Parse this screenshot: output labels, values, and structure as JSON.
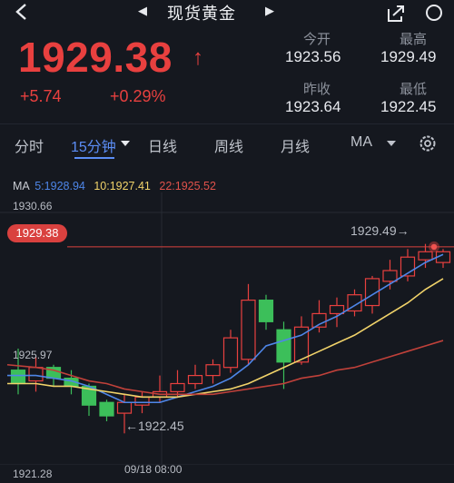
{
  "header": {
    "title": "现货黄金",
    "prev_icon": "triangle-left-icon",
    "next_icon": "triangle-right-icon"
  },
  "quote": {
    "price": "1929.38",
    "change": "+5.74",
    "change_pct": "+0.29%",
    "arrow": "↑",
    "color_up": "#e8403f",
    "color_down": "#3cbf5a"
  },
  "stats": {
    "open_label": "今开",
    "open": "1923.56",
    "high_label": "最高",
    "high": "1929.49",
    "prev_close_label": "昨收",
    "prev_close": "1923.64",
    "low_label": "最低",
    "low": "1922.45"
  },
  "tabs": {
    "fenshi": "分时",
    "min15": "15分钟",
    "daily": "日线",
    "weekly": "周线",
    "monthly": "月线",
    "ma": "MA"
  },
  "ma_legend": {
    "label": "MA",
    "ma5": "5:1928.94",
    "ma10": "10:1927.41",
    "ma22": "22:1925.52",
    "ma5_color": "#4e86e8",
    "ma10_color": "#f1d36a",
    "ma22_color": "#c0413a"
  },
  "axis": {
    "y_top": "1930.66",
    "y_mid": "1925.97",
    "y_bottom": "1921.28",
    "current_tag": "1929.38",
    "x_label": "09/18 08:00"
  },
  "annotations": {
    "high": "1929.49→",
    "low": "←1922.45"
  },
  "chart_data": {
    "type": "candlestick",
    "ylim": [
      1921.28,
      1930.66
    ],
    "current_price": 1929.38,
    "candles": [
      {
        "o": 1924.8,
        "h": 1925.6,
        "l": 1923.9,
        "c": 1924.3
      },
      {
        "o": 1924.4,
        "h": 1925.3,
        "l": 1924.0,
        "c": 1924.9
      },
      {
        "o": 1924.9,
        "h": 1925.0,
        "l": 1924.2,
        "c": 1924.5
      },
      {
        "o": 1924.5,
        "h": 1924.8,
        "l": 1923.9,
        "c": 1924.2
      },
      {
        "o": 1924.2,
        "h": 1924.3,
        "l": 1923.1,
        "c": 1923.5
      },
      {
        "o": 1923.6,
        "h": 1923.7,
        "l": 1922.9,
        "c": 1923.1
      },
      {
        "o": 1923.2,
        "h": 1923.9,
        "l": 1922.45,
        "c": 1923.6
      },
      {
        "o": 1923.5,
        "h": 1924.0,
        "l": 1923.2,
        "c": 1923.8
      },
      {
        "o": 1923.8,
        "h": 1924.6,
        "l": 1923.6,
        "c": 1924.0
      },
      {
        "o": 1924.0,
        "h": 1924.8,
        "l": 1923.8,
        "c": 1924.3
      },
      {
        "o": 1924.3,
        "h": 1925.0,
        "l": 1924.1,
        "c": 1924.6
      },
      {
        "o": 1924.6,
        "h": 1925.2,
        "l": 1924.3,
        "c": 1925.0
      },
      {
        "o": 1924.9,
        "h": 1926.3,
        "l": 1924.7,
        "c": 1926.0
      },
      {
        "o": 1925.2,
        "h": 1928.0,
        "l": 1925.0,
        "c": 1927.4
      },
      {
        "o": 1927.4,
        "h": 1927.6,
        "l": 1926.3,
        "c": 1926.6
      },
      {
        "o": 1926.3,
        "h": 1926.6,
        "l": 1924.1,
        "c": 1925.1
      },
      {
        "o": 1925.1,
        "h": 1926.8,
        "l": 1925.0,
        "c": 1926.4
      },
      {
        "o": 1926.4,
        "h": 1927.4,
        "l": 1926.2,
        "c": 1926.9
      },
      {
        "o": 1926.9,
        "h": 1927.5,
        "l": 1926.4,
        "c": 1927.2
      },
      {
        "o": 1927.0,
        "h": 1927.8,
        "l": 1926.8,
        "c": 1927.6
      },
      {
        "o": 1927.2,
        "h": 1928.3,
        "l": 1926.9,
        "c": 1928.2
      },
      {
        "o": 1928.1,
        "h": 1928.9,
        "l": 1927.8,
        "c": 1928.5
      },
      {
        "o": 1928.3,
        "h": 1929.3,
        "l": 1928.1,
        "c": 1929.0
      },
      {
        "o": 1928.9,
        "h": 1929.49,
        "l": 1928.6,
        "c": 1929.2
      },
      {
        "o": 1928.8,
        "h": 1929.3,
        "l": 1928.6,
        "c": 1929.2
      }
    ],
    "series": [
      {
        "name": "MA5",
        "values": [
          1924.6,
          1924.6,
          1924.5,
          1924.4,
          1924.2,
          1923.9,
          1923.6,
          1923.6,
          1923.6,
          1923.8,
          1924.0,
          1924.2,
          1924.5,
          1925.0,
          1925.7,
          1925.9,
          1926.1,
          1926.5,
          1926.8,
          1927.2,
          1927.6,
          1928.0,
          1928.4,
          1928.8,
          1929.1
        ]
      },
      {
        "name": "MA10",
        "values": [
          1924.3,
          1924.3,
          1924.2,
          1924.2,
          1924.1,
          1924.0,
          1923.9,
          1923.8,
          1923.8,
          1923.8,
          1923.9,
          1924.0,
          1924.1,
          1924.3,
          1924.6,
          1924.9,
          1925.2,
          1925.5,
          1925.8,
          1926.1,
          1926.5,
          1926.9,
          1927.3,
          1927.8,
          1928.2
        ]
      },
      {
        "name": "MA22",
        "values": [
          1925.0,
          1924.9,
          1924.8,
          1924.6,
          1924.4,
          1924.3,
          1924.1,
          1924.0,
          1923.9,
          1923.9,
          1923.9,
          1923.9,
          1924.0,
          1924.1,
          1924.2,
          1924.3,
          1924.5,
          1924.6,
          1924.8,
          1924.9,
          1925.1,
          1925.3,
          1925.5,
          1925.7,
          1925.9
        ]
      }
    ]
  }
}
